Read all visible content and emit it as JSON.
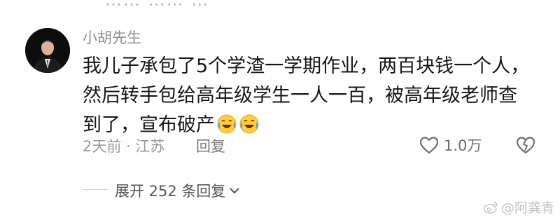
{
  "top_cut_text": "…… …… …",
  "comment": {
    "username": "小胡先生",
    "text": "我儿子承包了5个学渣一学期作业，两百块钱一个人，然后转手包给高年级学生一人一百，被高年级老师查到了，宣布破产",
    "emoji": [
      "face-with-tears-of-joy",
      "face-with-tears-of-joy"
    ],
    "time_location": "2天前 · 江苏",
    "reply_label": "回复",
    "like_count": "1.0万"
  },
  "expand": {
    "label": "展开 252 条回复"
  },
  "watermark": "@阿龚青"
}
